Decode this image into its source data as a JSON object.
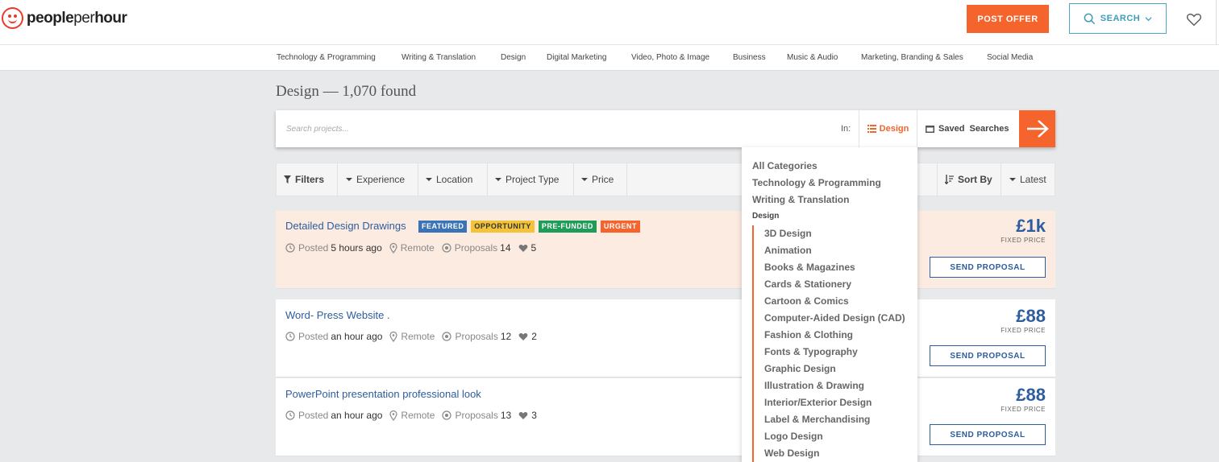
{
  "header": {
    "logo_bold": "people",
    "logo_light": "per",
    "logo_bold2": "hour",
    "post_offer": "POST OFFER",
    "search": "SEARCH"
  },
  "categories_nav": [
    "Technology & Programming",
    "Writing & Translation",
    "Design",
    "Digital Marketing",
    "Video, Photo & Image",
    "Business",
    "Music & Audio",
    "Marketing, Branding & Sales",
    "Social Media"
  ],
  "page": {
    "title": "Design — 1,070 found"
  },
  "searchbar": {
    "placeholder": "Search projects...",
    "in_label": "In:",
    "in_value": "Design",
    "saved_searches": "Saved  Searches"
  },
  "filters": {
    "filters": "Filters",
    "experience": "Experience",
    "location": "Location",
    "project_type": "Project Type",
    "price": "Price",
    "sort_by": "Sort By",
    "latest": "Latest"
  },
  "jobs": [
    {
      "title": "Detailed Design Drawings",
      "badges": [
        "FEATURED",
        "OPPORTUNITY",
        "PRE-FUNDED",
        "URGENT"
      ],
      "posted_label": "Posted",
      "posted": "5 hours ago",
      "location": "Remote",
      "proposals_label": "Proposals",
      "proposals": "14",
      "likes": "5",
      "price": "£1k",
      "price_type": "FIXED PRICE",
      "cta": "SEND PROPOSAL"
    },
    {
      "title": "Word- Press Website .",
      "posted_label": "Posted",
      "posted": "an hour ago",
      "location": "Remote",
      "proposals_label": "Proposals",
      "proposals": "12",
      "likes": "2",
      "price": "£88",
      "price_type": "FIXED PRICE",
      "cta": "SEND PROPOSAL"
    },
    {
      "title": "PowerPoint presentation professional look",
      "posted_label": "Posted",
      "posted": "an hour ago",
      "location": "Remote",
      "proposals_label": "Proposals",
      "proposals": "13",
      "likes": "3",
      "price": "£88",
      "price_type": "FIXED PRICE",
      "cta": "SEND PROPOSAL"
    }
  ],
  "dropdown": {
    "top_items": [
      "All Categories",
      "Technology & Programming",
      "Writing & Translation"
    ],
    "group": "Design",
    "sub_items": [
      "3D Design",
      "Animation",
      "Books & Magazines",
      "Cards & Stationery",
      "Cartoon & Comics",
      "Computer-Aided Design (CAD)",
      "Fashion & Clothing",
      "Fonts & Typography",
      "Graphic Design",
      "Illustration & Drawing",
      "Interior/Exterior Design",
      "Label & Merchandising",
      "Logo Design",
      "Web Design"
    ]
  },
  "colors": {
    "accent": "#f4642c",
    "link": "#2d5d9e",
    "search_outline": "#4aa8c4",
    "highlight_row": "#fcebe0"
  }
}
